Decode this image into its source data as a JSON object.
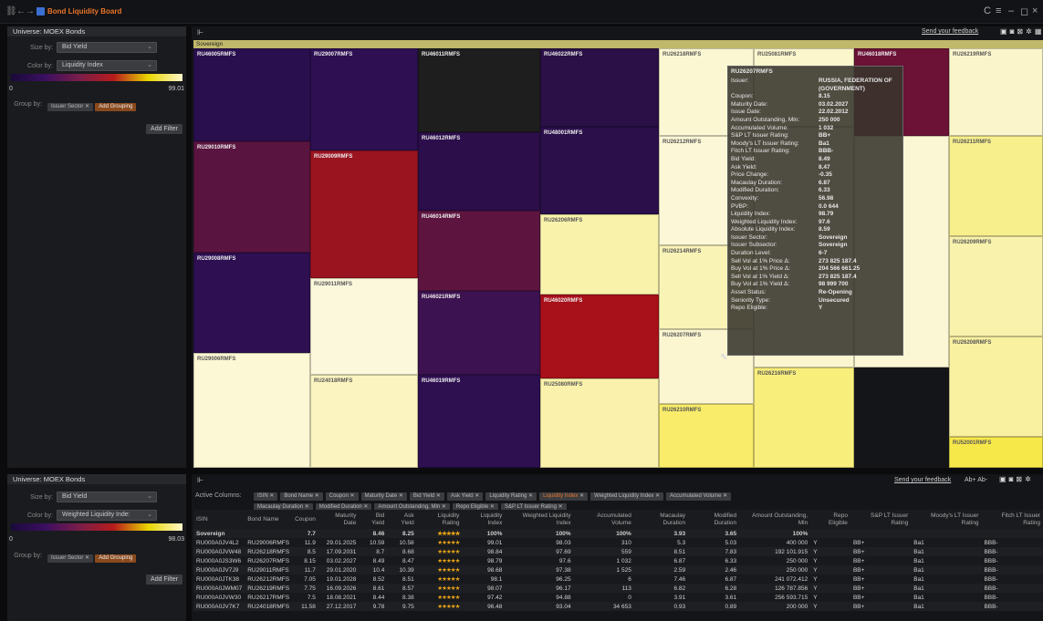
{
  "window": {
    "title": "Bond Liquidity Board"
  },
  "colors": {
    "accent": "#e8752a"
  },
  "left_top": {
    "universe": "Universe: MOEX Bonds",
    "size_by_label": "Size by:",
    "size_by_value": "Bid Yield",
    "color_by_label": "Color by:",
    "color_by_value": "Liquidity Index",
    "legend_min": "0",
    "legend_max": "99.01",
    "group_label": "Group by:",
    "group_chip": "Issuer Sector",
    "add_grouping": "Add Grouping",
    "add_filter": "Add Filter"
  },
  "left_bottom": {
    "universe": "Universe: MOEX Bonds",
    "size_by_label": "Size by:",
    "size_by_value": "Bid Yield",
    "color_by_label": "Color by:",
    "color_by_value": "Weighted Liquidity Inde:",
    "legend_min": "0",
    "legend_max": "98.03",
    "group_label": "Group by:",
    "group_chip": "Issuer Sector",
    "add_grouping": "Add Grouping",
    "add_filter": "Add Filter"
  },
  "treemap": {
    "feedback": "Send your feedback",
    "group": "Sovereign",
    "tiles": [
      {
        "label": "RU46005RMFS",
        "color": "#2a0f4f"
      },
      {
        "label": "RU29007RMFS",
        "color": "#2d0f52"
      },
      {
        "label": "RU46011RMFS",
        "color": "#1e1e1e"
      },
      {
        "label": "RU46022RMFS",
        "color": "#2a1046"
      },
      {
        "label": "RU26218RMFS",
        "color": "#fbf7d2"
      },
      {
        "label": "RU25081RMFS",
        "color": "#fbf6cc"
      },
      {
        "label": "RU46018RMFS",
        "color": "#6b1236"
      },
      {
        "label": "RU26219RMFS",
        "color": "#fbf5cc"
      },
      {
        "label": "RU46012RMFS",
        "color": "#2b0e4a"
      },
      {
        "label": "RU48001RMFS",
        "color": "#2a0f4a"
      },
      {
        "label": "RU26212RMFS",
        "color": "#fcf7d6"
      },
      {
        "label": "RU26211RMFS",
        "color": "#f7ef8c"
      },
      {
        "label": "RU29010RMFS",
        "color": "#5a1440"
      },
      {
        "label": "RU29009RMFS",
        "color": "#9a1420"
      },
      {
        "label": "RU46014RMFS",
        "color": "#5d1540"
      },
      {
        "label": "RU26206RMFS",
        "color": "#f9f2ab"
      },
      {
        "label": "RU26214RMFS",
        "color": "#f9f3b6"
      },
      {
        "label": "RU26209RMFS",
        "color": "#f9f2ad"
      },
      {
        "label": "RU29008RMFS",
        "color": "#2d0f52"
      },
      {
        "label": "RU29011RMFS",
        "color": "#fcf8dc"
      },
      {
        "label": "RU46021RMFS",
        "color": "#3d1250"
      },
      {
        "label": "RU46020RMFS",
        "color": "#a8101a"
      },
      {
        "label": "RU26207RMFS",
        "color": "#fbf6d0"
      },
      {
        "label": "RU29006RMFS",
        "color": "#fcf7d4"
      },
      {
        "label": "RU24018RMFS",
        "color": "#fbf4c0"
      },
      {
        "label": "RU46019RMFS",
        "color": "#2e0f50"
      },
      {
        "label": "RU25080RMFS",
        "color": "#faf2ac"
      },
      {
        "label": "RU26210RMFS",
        "color": "#f8ec6a"
      },
      {
        "label": "RU26216RMFS",
        "color": "#f8ee7c"
      },
      {
        "label": "RU26208RMFS",
        "color": "#f9f0a0"
      },
      {
        "label": "RU52001RMFS",
        "color": "#f7e84a"
      }
    ]
  },
  "tooltip": {
    "title": "RU26207RMFS",
    "rows": [
      [
        "Issuer:",
        "RUSSIA, FEDERATION OF (GOVERNMENT)"
      ],
      [
        "Coupon:",
        "8.15"
      ],
      [
        "Maturity Date:",
        "03.02.2027"
      ],
      [
        "Issue Date:",
        "22.02.2012"
      ],
      [
        "Amount Outstanding, Mln:",
        "250 000"
      ],
      [
        "Accumulated Volume:",
        "1 032"
      ],
      [
        "S&P LT Issuer Rating:",
        "BB+"
      ],
      [
        "Moody's LT Issuer Rating:",
        "Ba1"
      ],
      [
        "Fitch LT Issuer Rating:",
        "BBB-"
      ],
      [
        "Bid Yield:",
        "8.49"
      ],
      [
        "Ask Yield:",
        "8.47"
      ],
      [
        "Price Change:",
        "-0.35"
      ],
      [
        "Macaulay Duration:",
        "6.87"
      ],
      [
        "Modified Duration:",
        "6.33"
      ],
      [
        "Convexity:",
        "56.98"
      ],
      [
        "PVBP:",
        "0.0 644"
      ],
      [
        "Liquidity Index:",
        "98.79"
      ],
      [
        "Weighted Liquidity Index:",
        "97.6"
      ],
      [
        "Absolute Liquidity Index:",
        "8.59"
      ],
      [
        "Issuer Sector:",
        "Sovereign"
      ],
      [
        "Issuer Subsector:",
        "Sovereign"
      ],
      [
        "Duration Level:",
        "6-7"
      ],
      [
        "Sell Vol at 1% Price Δ:",
        "273 825 187.4"
      ],
      [
        "Buy Vol at 1% Price Δ:",
        "204 566 661.25"
      ],
      [
        "Sell Vol at 1% Yield Δ:",
        "273 825 187.4"
      ],
      [
        "Buy Vol at 1% Yield Δ:",
        "98 999 700"
      ],
      [
        "Asset Status:",
        "Re-Opening"
      ],
      [
        "Seniority Type:",
        "Unsecured"
      ],
      [
        "Repo Eligible:",
        "Y"
      ]
    ]
  },
  "table": {
    "feedback": "Send your feedback",
    "active_columns_label": "Active Columns:",
    "active_columns": [
      "ISIN",
      "Bond Name",
      "Coupon",
      "Maturity Date",
      "Bid Yield",
      "Ask Yield",
      "Liquidity Rating",
      "Liquidity Index",
      "Weighted Liquidity Index",
      "Accumulated Volume",
      "Macaulay Duration",
      "Modified Duration",
      "Amount Outstanding, Mln",
      "Repo Eligible",
      "S&P LT Issuer Rating"
    ],
    "headers": [
      "ISIN",
      "Bond Name",
      "Coupon",
      "Maturity Date",
      "Bid Yield",
      "Ask Yield",
      "Liquidity Rating",
      "Liquidity Index",
      "Weighted Liquidity Index",
      "Accumulated Volume",
      "Macaulay Duration",
      "Modified Duration",
      "Amount Outstanding, Mln",
      "Repo Eligible",
      "S&P LT Issuer Rating",
      "Moody's LT Issuer Rating",
      "Fitch LT Issuer Rating"
    ],
    "rows": [
      [
        "Sovereign",
        "",
        "7.7",
        "",
        "8.46",
        "8.25",
        "★★★★★",
        "100%",
        "100%",
        "100%",
        "3.93",
        "3.65",
        "100%",
        "",
        "",
        "",
        ""
      ],
      [
        "RU000A0JV4L2",
        "RU29006RMFS",
        "11.9",
        "29.01.2025",
        "10.59",
        "10.58",
        "★★★★★",
        "99.01",
        "98.03",
        "310",
        "5.3",
        "5.03",
        "400 000",
        "Y",
        "BB+",
        "Ba1",
        "BBB-"
      ],
      [
        "RU000A0JVW48",
        "RU26218RMFS",
        "8.5",
        "17.09.2031",
        "8.7",
        "8.68",
        "★★★★★",
        "98.84",
        "97.69",
        "559",
        "8.51",
        "7.83",
        "192 101.915",
        "Y",
        "BB+",
        "Ba1",
        "BBB-"
      ],
      [
        "RU000A0JS3W6",
        "RU26207RMFS",
        "8.15",
        "03.02.2027",
        "8.49",
        "8.47",
        "★★★★★",
        "98.79",
        "97.6",
        "1 032",
        "6.87",
        "6.33",
        "250 000",
        "Y",
        "BB+",
        "Ba1",
        "BBB-"
      ],
      [
        "RU000A0JV7J9",
        "RU29011RMFS",
        "11.7",
        "29.01.2020",
        "10.4",
        "10.39",
        "★★★★★",
        "98.68",
        "97.38",
        "1 525",
        "2.59",
        "2.46",
        "250 000",
        "Y",
        "BB+",
        "Ba1",
        "BBB-"
      ],
      [
        "RU000A0JTK38",
        "RU26212RMFS",
        "7.05",
        "19.01.2028",
        "8.52",
        "8.51",
        "★★★★★",
        "98.1",
        "96.25",
        "6",
        "7.46",
        "6.87",
        "241 072.412",
        "Y",
        "BB+",
        "Ba1",
        "BBB-"
      ],
      [
        "RU000A0JWM07",
        "RU26219RMFS",
        "7.75",
        "16.09.2026",
        "8.61",
        "8.57",
        "★★★★★",
        "98.07",
        "96.17",
        "113",
        "6.82",
        "6.28",
        "126 787.856",
        "Y",
        "BB+",
        "Ba1",
        "BBB-"
      ],
      [
        "RU000A0JVW30",
        "RU26217RMFS",
        "7.5",
        "18.08.2021",
        "8.44",
        "8.38",
        "★★★★★",
        "97.42",
        "94.88",
        "0",
        "3.91",
        "3.61",
        "256 593.715",
        "Y",
        "BB+",
        "Ba1",
        "BBB-"
      ],
      [
        "RU000A0JV7K7",
        "RU24018RMFS",
        "11.58",
        "27.12.2017",
        "9.78",
        "9.75",
        "★★★★★",
        "96.48",
        "93.04",
        "34 653",
        "0.93",
        "0.89",
        "200 000",
        "Y",
        "BB+",
        "Ba1",
        "BBB-"
      ]
    ]
  }
}
